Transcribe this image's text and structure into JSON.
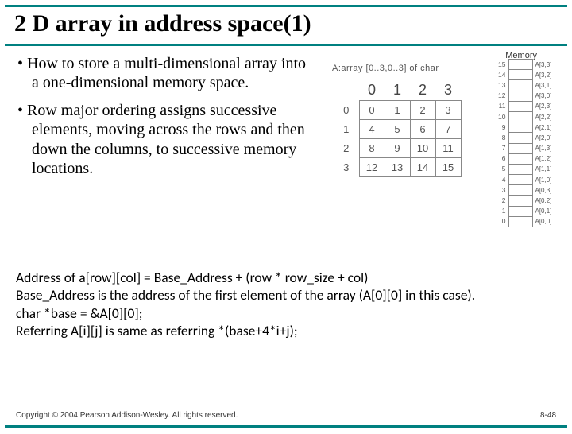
{
  "title": "2 D array in address space(1)",
  "bullets": [
    "How to store a multi-dimensional array into a one-dimensional memory space.",
    "Row major ordering assigns successive elements, moving across the rows and then down the columns, to successive memory locations."
  ],
  "figure": {
    "array_decl": "A:array [0..3,0..3] of char",
    "memory_title": "Memory",
    "col_headers": [
      "0",
      "1",
      "2",
      "3"
    ],
    "row_headers": [
      "0",
      "1",
      "2",
      "3"
    ],
    "grid": [
      [
        "0",
        "1",
        "2",
        "3"
      ],
      [
        "4",
        "5",
        "6",
        "7"
      ],
      [
        "8",
        "9",
        "10",
        "11"
      ],
      [
        "12",
        "13",
        "14",
        "15"
      ]
    ],
    "memory": [
      {
        "addr": "15",
        "label": "A[3,3]"
      },
      {
        "addr": "14",
        "label": "A[3,2]"
      },
      {
        "addr": "13",
        "label": "A[3,1]"
      },
      {
        "addr": "12",
        "label": "A[3,0]"
      },
      {
        "addr": "11",
        "label": "A[2,3]"
      },
      {
        "addr": "10",
        "label": "A[2,2]"
      },
      {
        "addr": "9",
        "label": "A[2,1]"
      },
      {
        "addr": "8",
        "label": "A[2,0]"
      },
      {
        "addr": "7",
        "label": "A[1,3]"
      },
      {
        "addr": "6",
        "label": "A[1,2]"
      },
      {
        "addr": "5",
        "label": "A[1,1]"
      },
      {
        "addr": "4",
        "label": "A[1,0]"
      },
      {
        "addr": "3",
        "label": "A[0,3]"
      },
      {
        "addr": "2",
        "label": "A[0,2]"
      },
      {
        "addr": "1",
        "label": "A[0,1]"
      },
      {
        "addr": "0",
        "label": "A[0,0]"
      }
    ]
  },
  "formula": {
    "l1": "Address of a[row][col]  = Base_Address + (row * row_size + col)",
    "l2": "Base_Address is the address of the first element of the array (A[0][0] in this case).",
    "l3": "char *base = &A[0][0];",
    "l4": "Referring A[i][j] is same as referring *(base+4*i+j);"
  },
  "footer": {
    "copyright": "Copyright © 2004 Pearson Addison-Wesley. All rights reserved.",
    "page": "8-48"
  }
}
